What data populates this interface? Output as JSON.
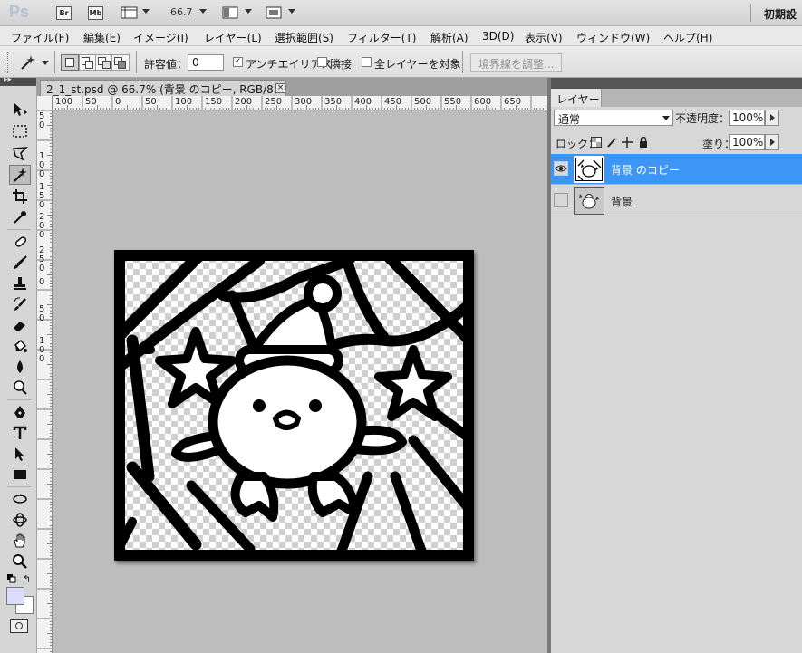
{
  "app": {
    "logo": "Ps",
    "bridge_label": "Br",
    "minibridge_label": "Mb",
    "zoom": "66.7",
    "workspace": "初期設"
  },
  "menu": [
    "ファイル(F)",
    "編集(E)",
    "イメージ(I)",
    "レイヤー(L)",
    "選択範囲(S)",
    "フィルター(T)",
    "解析(A)",
    "3D(D)",
    "表示(V)",
    "ウィンドウ(W)",
    "ヘルプ(H)"
  ],
  "options": {
    "tolerance_label": "許容値：",
    "tolerance_value": "0",
    "antialias_label": "アンチエイリアス",
    "antialias_checked": true,
    "contiguous_label": "隣接",
    "contiguous_checked": false,
    "all_layers_label": "全レイヤーを対象",
    "all_layers_checked": false,
    "refine_edge_label": "境界線を調整..."
  },
  "document": {
    "tab_title": "2_1_st.psd @ 66.7% (背景 のコピー, RGB/8) *",
    "close_glyph": "×",
    "ruler_top": [
      "100",
      "50",
      "0",
      "50",
      "100",
      "150",
      "200",
      "250",
      "300",
      "350",
      "400",
      "450",
      "500",
      "550",
      "600",
      "650"
    ],
    "ruler_left": [
      "5",
      "0",
      "1",
      "0",
      "0",
      "1",
      "5",
      "0",
      "2",
      "0",
      "0",
      "2",
      "5",
      "0",
      "0",
      "5",
      "0",
      "1",
      "0",
      "0"
    ]
  },
  "layers_panel": {
    "tab": "レイヤー",
    "blend_mode": "通常",
    "opacity_label": "不透明度：",
    "opacity_value": "100%",
    "lock_label": "ロック：",
    "fill_label": "塗り：",
    "fill_value": "100%",
    "layers": [
      {
        "name": "背景 のコピー",
        "visible": true,
        "selected": true
      },
      {
        "name": "背景",
        "visible": false,
        "selected": false
      }
    ]
  },
  "colors": {
    "selection_blue": "#3d96f5",
    "foreground": "#000000",
    "background_swatch": "#dcdcff"
  },
  "tools": [
    "move-tool-icon",
    "marquee-tool-icon",
    "lasso-tool-icon",
    "magic-wand-tool-icon",
    "crop-tool-icon",
    "eyedropper-tool-icon",
    "healing-brush-tool-icon",
    "brush-tool-icon",
    "clone-stamp-tool-icon",
    "history-brush-tool-icon",
    "eraser-tool-icon",
    "paint-bucket-tool-icon",
    "blur-tool-icon",
    "dodge-tool-icon",
    "pen-tool-icon",
    "type-tool-icon",
    "path-selection-tool-icon",
    "rectangle-tool-icon",
    "3d-rotate-tool-icon",
    "3d-orbit-tool-icon",
    "hand-tool-icon",
    "zoom-tool-icon"
  ]
}
